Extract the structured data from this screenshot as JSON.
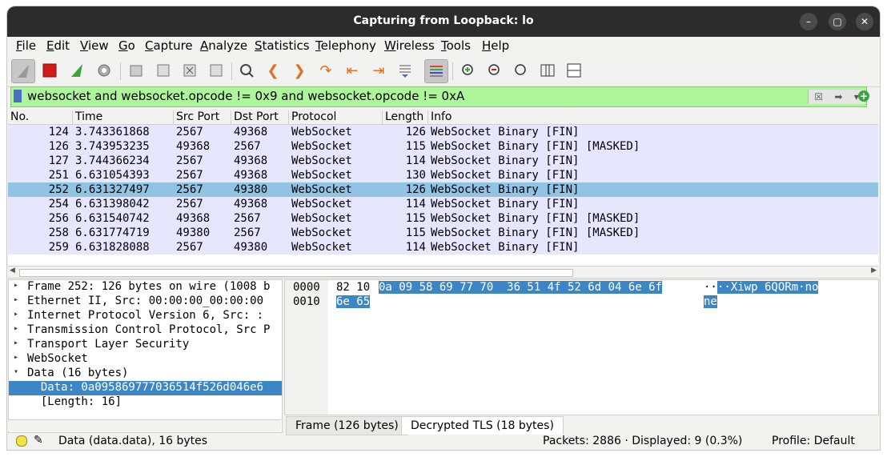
{
  "window": {
    "title": "Capturing from Loopback: lo"
  },
  "menu": [
    "File",
    "Edit",
    "View",
    "Go",
    "Capture",
    "Analyze",
    "Statistics",
    "Telephony",
    "Wireless",
    "Tools",
    "Help"
  ],
  "filter": {
    "value": "websocket and websocket.opcode != 0x9 and websocket.opcode != 0xA"
  },
  "columns": [
    "No.",
    "Time",
    "Src Port",
    "Dst Port",
    "Protocol",
    "Length",
    "Info"
  ],
  "packets": [
    {
      "no": "124",
      "time": "3.743361868",
      "src": "2567",
      "dst": "49368",
      "proto": "WebSocket",
      "len": "126",
      "info": "WebSocket Binary [FIN]"
    },
    {
      "no": "126",
      "time": "3.743953235",
      "src": "49368",
      "dst": "2567",
      "proto": "WebSocket",
      "len": "115",
      "info": "WebSocket Binary [FIN] [MASKED]"
    },
    {
      "no": "127",
      "time": "3.744366234",
      "src": "2567",
      "dst": "49368",
      "proto": "WebSocket",
      "len": "114",
      "info": "WebSocket Binary [FIN]"
    },
    {
      "no": "251",
      "time": "6.631054393",
      "src": "2567",
      "dst": "49368",
      "proto": "WebSocket",
      "len": "130",
      "info": "WebSocket Binary [FIN]"
    },
    {
      "no": "252",
      "time": "6.631327497",
      "src": "2567",
      "dst": "49380",
      "proto": "WebSocket",
      "len": "126",
      "info": "WebSocket Binary [FIN]"
    },
    {
      "no": "254",
      "time": "6.631398042",
      "src": "2567",
      "dst": "49368",
      "proto": "WebSocket",
      "len": "114",
      "info": "WebSocket Binary [FIN]"
    },
    {
      "no": "256",
      "time": "6.631540742",
      "src": "49368",
      "dst": "2567",
      "proto": "WebSocket",
      "len": "115",
      "info": "WebSocket Binary [FIN] [MASKED]"
    },
    {
      "no": "258",
      "time": "6.631774719",
      "src": "49380",
      "dst": "2567",
      "proto": "WebSocket",
      "len": "115",
      "info": "WebSocket Binary [FIN] [MASKED]"
    },
    {
      "no": "259",
      "time": "6.631828088",
      "src": "2567",
      "dst": "49380",
      "proto": "WebSocket",
      "len": "114",
      "info": "WebSocket Binary [FIN]"
    }
  ],
  "details": [
    {
      "arrow": "▸",
      "text": "Frame 252: 126 bytes on wire (1008 b"
    },
    {
      "arrow": "▸",
      "text": "Ethernet II, Src: 00:00:00_00:00:00"
    },
    {
      "arrow": "▸",
      "text": "Internet Protocol Version 6, Src: :"
    },
    {
      "arrow": "▸",
      "text": "Transmission Control Protocol, Src P"
    },
    {
      "arrow": "▸",
      "text": "Transport Layer Security"
    },
    {
      "arrow": "▸",
      "text": "WebSocket"
    },
    {
      "arrow": "▾",
      "text": "Data (16 bytes)"
    },
    {
      "arrow": "",
      "text": "  Data: 0a095869777036514f526d046e6"
    },
    {
      "arrow": "",
      "text": "  [Length: 16]"
    }
  ],
  "bytes": {
    "offsets": [
      "0000",
      "0010"
    ],
    "row1_plain": "82 10",
    "row1_hl": "0a 09 58 69 77 70  36 51 4f 52 6d 04 6e 6f",
    "row2_hl": "6e 65",
    "row1_ascii_plain": "··",
    "row1_ascii_hl": "··Xiwp 6QORm·no",
    "row2_ascii_hl": "ne"
  },
  "byte_tabs": [
    "Frame (126 bytes)",
    "Decrypted TLS (18 bytes)"
  ],
  "status": {
    "field": "Data (data.data), 16 bytes",
    "packets": "Packets: 2886 · Displayed: 9 (0.3%)",
    "profile": "Profile: Default"
  }
}
